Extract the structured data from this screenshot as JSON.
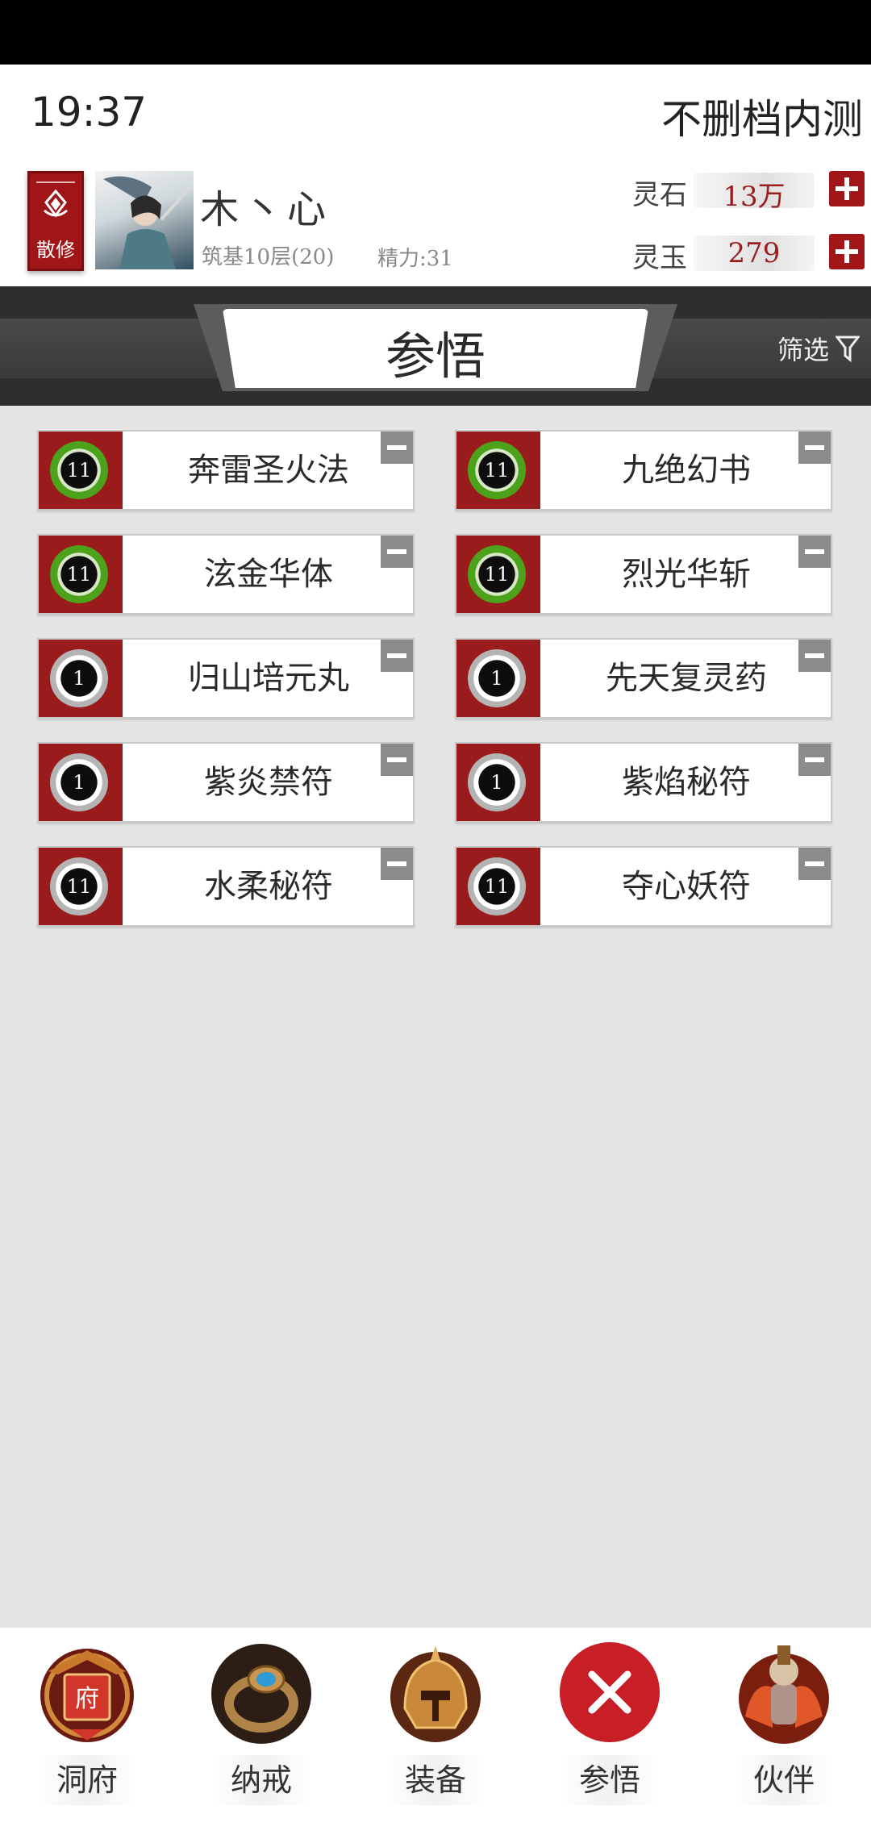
{
  "status": {
    "time": "19:37",
    "server": "不删档内测"
  },
  "player": {
    "sect": "散修",
    "name": "木丶心",
    "level": "筑基10层(20)",
    "stamina": "精力:31"
  },
  "resources": [
    {
      "label": "灵石",
      "value": "13万"
    },
    {
      "label": "灵玉",
      "value": "279"
    }
  ],
  "panel": {
    "title": "参悟",
    "filter_label": "筛选"
  },
  "items": [
    {
      "name": "奔雷圣火法",
      "level": "11",
      "ring": "green"
    },
    {
      "name": "九绝幻书",
      "level": "11",
      "ring": "green"
    },
    {
      "name": "泫金华体",
      "level": "11",
      "ring": "green"
    },
    {
      "name": "烈光华斩",
      "level": "11",
      "ring": "green"
    },
    {
      "name": "归山培元丸",
      "level": "1",
      "ring": "gray"
    },
    {
      "name": "先天复灵药",
      "level": "1",
      "ring": "gray"
    },
    {
      "name": "紫炎禁符",
      "level": "1",
      "ring": "gray"
    },
    {
      "name": "紫焰秘符",
      "level": "1",
      "ring": "gray"
    },
    {
      "name": "水柔秘符",
      "level": "11",
      "ring": "gray"
    },
    {
      "name": "夺心妖符",
      "level": "11",
      "ring": "gray"
    }
  ],
  "nav": [
    {
      "label": "洞府",
      "icon": "cave-mansion-icon"
    },
    {
      "label": "纳戒",
      "icon": "storage-ring-icon"
    },
    {
      "label": "装备",
      "icon": "helmet-icon"
    },
    {
      "label": "参悟",
      "icon": "close-icon",
      "active": true
    },
    {
      "label": "伙伴",
      "icon": "companion-icon"
    }
  ],
  "colors": {
    "accent_red": "#a11618",
    "resource_text": "#9a1d1f",
    "ring_green": "#4da21c"
  }
}
